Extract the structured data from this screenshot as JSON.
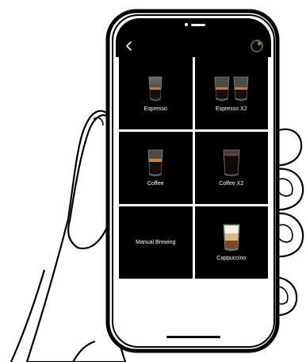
{
  "app": {
    "back_icon": "chevron-left-icon",
    "status_icon": "ring-progress-icon",
    "accent_color": "#4caf50"
  },
  "tiles": [
    {
      "label": "Espresso",
      "icon": "espresso-cup-icon"
    },
    {
      "label": "Espresso X2",
      "icon": "double-espresso-cups-icon"
    },
    {
      "label": "Coffee",
      "icon": "coffee-cup-icon"
    },
    {
      "label": "Coffee X2",
      "icon": "dark-coffee-cup-icon"
    },
    {
      "label": "Manual Brewing",
      "icon": ""
    },
    {
      "label": "Cappuccino",
      "icon": "cappuccino-cup-icon"
    }
  ]
}
